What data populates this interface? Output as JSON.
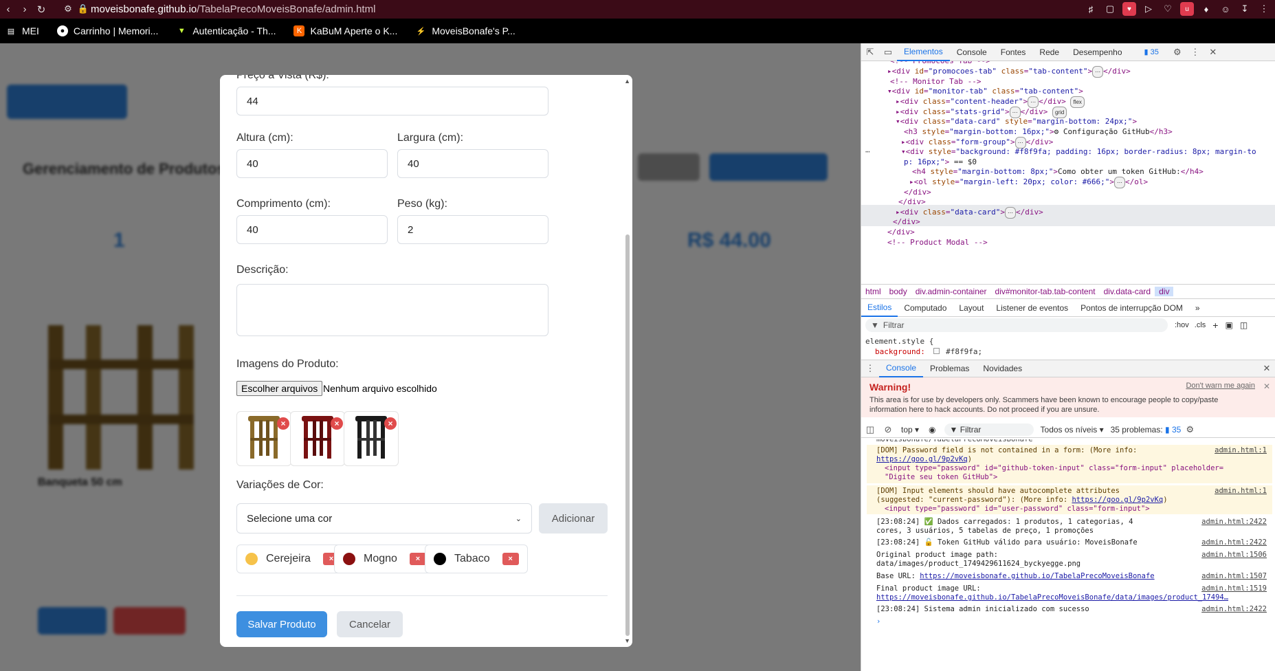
{
  "browser": {
    "url_host": "moveisbonafe.github.io",
    "url_path": "/TabelaPrecoMoveisBonafe/admin.html",
    "bookmarks": [
      {
        "label": "MEI"
      },
      {
        "label": "Carrinho | Memori..."
      },
      {
        "label": "Autenticação - Th..."
      },
      {
        "label": "KaBuM Aperte o K..."
      },
      {
        "label": "MoveisBonafe's P..."
      }
    ]
  },
  "background_page": {
    "heading": "Gerenciamento de Produtos",
    "stat_value": "1",
    "stat_price": "R$ 44.00",
    "product_name": "Banqueta 50 cm"
  },
  "modal": {
    "price_label": "Preço à Vista (R$):",
    "price_value": "44",
    "height_label": "Altura (cm):",
    "height_value": "40",
    "width_label": "Largura (cm):",
    "width_value": "40",
    "length_label": "Comprimento (cm):",
    "length_value": "40",
    "weight_label": "Peso (kg):",
    "weight_value": "2",
    "description_label": "Descrição:",
    "images_label": "Imagens do Produto:",
    "file_button": "Escolher arquivos",
    "file_status": "Nenhum arquivo escolhido",
    "images": [
      {
        "color": "#8a6a2a"
      },
      {
        "color": "#7a1212"
      },
      {
        "color": "#1a1a1a"
      }
    ],
    "colors_label": "Variações de Cor:",
    "select_placeholder": "Selecione uma cor",
    "add_button": "Adicionar",
    "color_chips": [
      {
        "name": "Cerejeira",
        "color": "#f6c24a"
      },
      {
        "name": "Mogno",
        "color": "#8b1010"
      },
      {
        "name": "Tabaco",
        "color": "#000000"
      }
    ],
    "remove_symbol": "×",
    "save_button": "Salvar Produto",
    "cancel_button": "Cancelar"
  },
  "devtools": {
    "tabs": [
      "Elementos",
      "Console",
      "Fontes",
      "Rede",
      "Desempenho"
    ],
    "issues_count": "35",
    "breadcrumbs": [
      "html",
      "body",
      "div.admin-container",
      "div#monitor-tab.tab-content",
      "div.data-card",
      "div"
    ],
    "style_tabs": [
      "Estilos",
      "Computado",
      "Layout",
      "Listener de eventos",
      "Pontos de interrupção DOM"
    ],
    "filter_placeholder": "Filtrar",
    "filter_hov": ":hov",
    "filter_cls": ".cls",
    "element_style_line": "element.style {",
    "element_style_prop": "background:",
    "element_style_val": "#f8f9fa;",
    "drawer_tabs": [
      "Console",
      "Problemas",
      "Novidades"
    ],
    "warning_title": "Warning!",
    "warning_body": "This area is for use by developers only. Scammers have been known to encourage people to copy/paste information here to hack accounts. Do not proceed if you are unsure.",
    "warning_link": "Don't warn me again",
    "console_context": "top",
    "console_filter": "Filtrar",
    "console_levels": "Todos os níveis",
    "console_problems": "35 problemas:",
    "console_problems_count": "35"
  }
}
